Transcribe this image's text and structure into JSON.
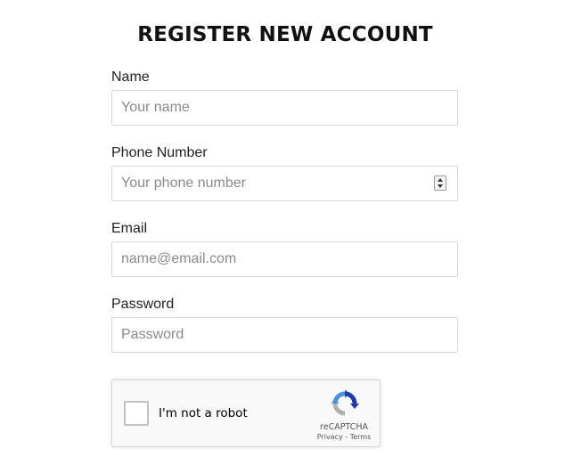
{
  "form": {
    "title": "REGISTER NEW ACCOUNT",
    "fields": {
      "name": {
        "label": "Name",
        "placeholder": "Your name",
        "value": ""
      },
      "phone": {
        "label": "Phone Number",
        "placeholder": "Your phone number",
        "value": ""
      },
      "email": {
        "label": "Email",
        "placeholder": "name@email.com",
        "value": ""
      },
      "password": {
        "label": "Password",
        "placeholder": "Password",
        "value": ""
      }
    }
  },
  "captcha": {
    "checkbox_label": "I'm not a robot",
    "brand": "reCAPTCHA",
    "privacy_link": "Privacy",
    "separator": " - ",
    "terms_link": "Terms",
    "logo_icon": "recaptcha-logo-icon"
  },
  "colors": {
    "recaptcha_blue_dark": "#1c3aa9",
    "recaptcha_blue_light": "#4a90e2",
    "recaptcha_gray": "#b0b0b0"
  }
}
